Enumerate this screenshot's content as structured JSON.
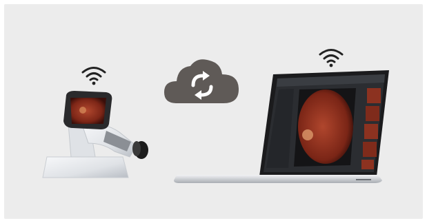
{
  "scene": {
    "background": "#ececec",
    "cloud_color": "#5f5a57",
    "wifi_color": "#222222",
    "device_body_color": "#e4e6e9",
    "retina_color": "#8a2e1e"
  },
  "icons": {
    "device_wifi": "wifi-icon",
    "laptop_wifi": "wifi-icon",
    "cloud": "cloud-sync-icon"
  },
  "laptop": {
    "app_gallery_count": 5
  }
}
